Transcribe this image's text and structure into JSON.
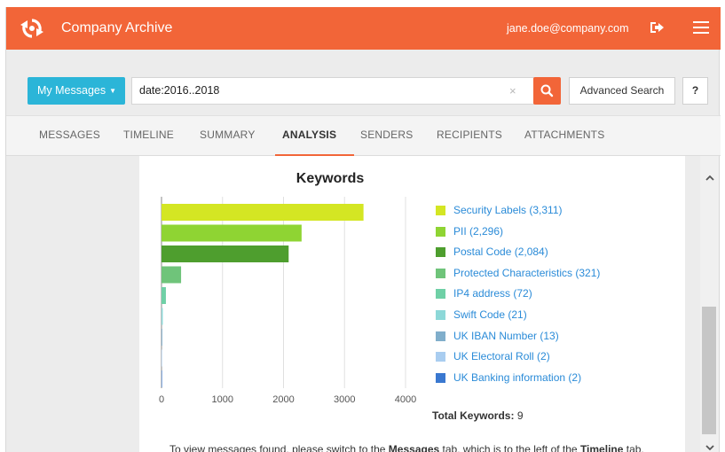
{
  "header": {
    "app_title": "Company Archive",
    "user_email": "jane.doe@company.com",
    "brand_color": "#f26538"
  },
  "search": {
    "scope_label": "My Messages",
    "query": "date:2016..2018",
    "clear_label": "×",
    "advanced_label": "Advanced Search",
    "help_label": "?",
    "scope_color": "#2bb5d8"
  },
  "tabs": [
    {
      "label": "MESSAGES",
      "active": false
    },
    {
      "label": "TIMELINE",
      "active": false
    },
    {
      "label": "SUMMARY",
      "active": false
    },
    {
      "label": "ANALYSIS",
      "active": true
    },
    {
      "label": "SENDERS",
      "active": false
    },
    {
      "label": "RECIPIENTS",
      "active": false
    },
    {
      "label": "ATTACHMENTS",
      "active": false
    }
  ],
  "analysis": {
    "total_label": "Total Keywords:",
    "total_value": "9",
    "footer_parts": [
      "To view messages found, please switch to the ",
      "Messages",
      " tab, which is to the left of the ",
      "Timeline",
      " tab."
    ]
  },
  "chart_data": {
    "type": "bar",
    "orientation": "horizontal",
    "title": "Keywords",
    "xlim": [
      0,
      4000
    ],
    "x_ticks": [
      0,
      1000,
      2000,
      3000,
      4000
    ],
    "grid": true,
    "legend_position": "right",
    "categories": [
      "Security Labels",
      "PII",
      "Postal Code",
      "Protected Characteristics",
      "IP4 address",
      "Swift Code",
      "UK IBAN Number",
      "UK Electoral Roll",
      "UK Banking information"
    ],
    "legend_labels": [
      "Security Labels (3,311)",
      "PII (2,296)",
      "Postal Code (2,084)",
      "Protected Characteristics (321)",
      "IP4 address (72)",
      "Swift Code (21)",
      "UK IBAN Number (13)",
      "UK Electoral Roll (2)",
      "UK Banking information (2)"
    ],
    "values": [
      3311,
      2296,
      2084,
      321,
      72,
      21,
      13,
      2,
      2
    ],
    "colors": [
      "#d4e623",
      "#8fd433",
      "#4e9e2e",
      "#6fc47a",
      "#6fd0a6",
      "#8dd8d8",
      "#80aecb",
      "#a9cdf0",
      "#3a78d0"
    ]
  }
}
